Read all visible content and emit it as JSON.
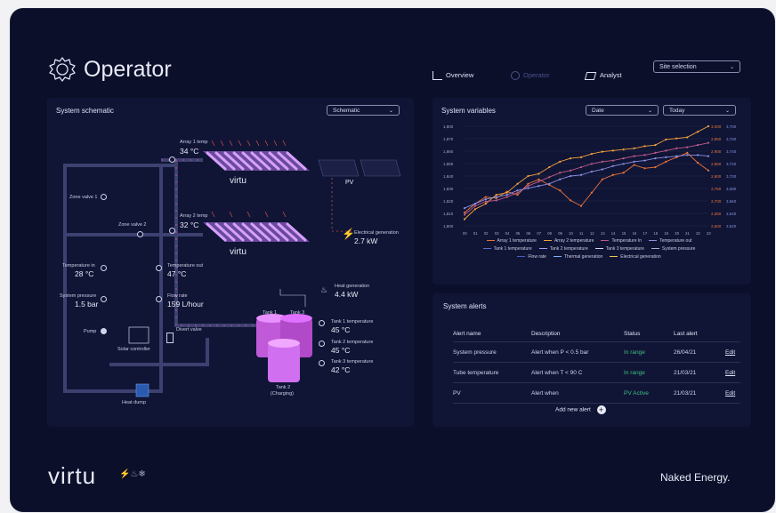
{
  "header": {
    "title": "Operator",
    "nav": [
      {
        "label": "Overview",
        "icon": "bar-chart-icon"
      },
      {
        "label": "Operator",
        "icon": "gear-icon"
      },
      {
        "label": "Analyst",
        "icon": "cube-icon"
      }
    ],
    "site_selection": "Site selection"
  },
  "schematic": {
    "title": "System schematic",
    "view_select": "Schematic",
    "array1": {
      "label": "Array 1 temp",
      "value": "34 °C"
    },
    "array2": {
      "label": "Array 2 temp",
      "value": "32 °C"
    },
    "array_brand": "virtu",
    "pv_label": "PV",
    "zone_valve_1": "Zone valve 1",
    "zone_valve_2": "Zone valve 2",
    "electrical_gen": {
      "label": "Electrical generation",
      "value": "2.7 kW"
    },
    "temp_in": {
      "label": "Temperature in",
      "value": "28 °C"
    },
    "temp_out": {
      "label": "Temperature out",
      "value": "47 °C"
    },
    "system_pressure": {
      "label": "System pressure",
      "value": "1.5 bar"
    },
    "flow_rate": {
      "label": "Flow rate",
      "value": "159 L/hour"
    },
    "heat_gen": {
      "label": "Heat generation",
      "value": "4.4 kW"
    },
    "pump": "Pump",
    "solar_controller": "Solar controller",
    "divert_valve": "Divert valve",
    "tank1": "Tank 1",
    "tank3": "Tank 3",
    "tank2": "Tank 2",
    "tank2_state": "(Charging)",
    "tank1_temp": {
      "label": "Tank 1 temperature",
      "value": "45 °C"
    },
    "tank2_temp": {
      "label": "Tank 2 temperature",
      "value": "45 °C"
    },
    "tank3_temp": {
      "label": "Tank 3 temperature",
      "value": "42 °C"
    },
    "heat_dump": "Heat dump"
  },
  "variables": {
    "title": "System variables",
    "date_select": "Date",
    "range_select": "Today"
  },
  "chart_data": {
    "type": "line",
    "x": [
      "00",
      "01",
      "02",
      "03",
      "04",
      "05",
      "06",
      "07",
      "08",
      "09",
      "10",
      "11",
      "12",
      "13",
      "14",
      "15",
      "16",
      "17",
      "18",
      "19",
      "20",
      "21",
      "22",
      "23"
    ],
    "left_ticks": [
      "1,800",
      "1,870",
      "1,860",
      "1,850",
      "1,840",
      "1,830",
      "1,820",
      "1,810",
      "1,800"
    ],
    "right_ticks_a": [
      "3,000",
      "2,950",
      "2,900",
      "2,850",
      "2,800",
      "2,750",
      "2,700",
      "2,650",
      "2,600"
    ],
    "right_ticks_b": [
      "3,700",
      "3,760",
      "3,740",
      "3,720",
      "3,700",
      "3,680",
      "3,660",
      "3,640",
      "3,620"
    ],
    "series": [
      {
        "name": "Array 1 temperature",
        "color": "#e8733a",
        "values": [
          1812,
          1820,
          1826,
          1825,
          1831,
          1828,
          1838,
          1842,
          1837,
          1832,
          1823,
          1818,
          1830,
          1842,
          1846,
          1848,
          1855,
          1852,
          1853,
          1858,
          1862,
          1866,
          1857,
          1850
        ]
      },
      {
        "name": "Array 2 temperature",
        "color": "#f2a03a",
        "values": [
          1806,
          1815,
          1820,
          1828,
          1830,
          1838,
          1845,
          1847,
          1853,
          1858,
          1861,
          1862,
          1865,
          1867,
          1868,
          1869,
          1870,
          1872,
          1873,
          1878,
          1879,
          1880,
          1885,
          1890
        ]
      },
      {
        "name": "Temperature In",
        "color": "#c05a8a",
        "values": [
          1810,
          1818,
          1822,
          1823,
          1826,
          1830,
          1836,
          1840,
          1844,
          1848,
          1850,
          1853,
          1856,
          1858,
          1859,
          1861,
          1863,
          1864,
          1866,
          1868,
          1870,
          1871,
          1873,
          1875
        ]
      },
      {
        "name": "Temperature out",
        "color": "#8a8fe0",
        "values": [
          1816,
          1820,
          1824,
          1826,
          1828,
          1832,
          1834,
          1836,
          1838,
          1842,
          1845,
          1846,
          1849,
          1851,
          1854,
          1856,
          1858,
          1859,
          1861,
          1862,
          1863,
          1864,
          1864,
          1863
        ]
      }
    ],
    "legend": [
      "Array 1 temperature",
      "Array 2 temperature",
      "Temperature In",
      "Temperature out",
      "Tank 1 temperature",
      "Tank 2 temperature",
      "Tank 3 temperature",
      "System pressure",
      "Flow rate",
      "Thermal generation",
      "Electrical generation"
    ],
    "legend_colors": [
      "#e8733a",
      "#f2a03a",
      "#c05a8a",
      "#8a8fe0",
      "#5a6fd0",
      "#9aa4ff",
      "#d6d8f2",
      "#b0b3d0",
      "#4a5cc0",
      "#7fb0ff",
      "#f2c55a"
    ],
    "ylim": [
      1800,
      1890
    ]
  },
  "alerts": {
    "title": "System alerts",
    "headers": [
      "Alert name",
      "Description",
      "Status",
      "Last alert"
    ],
    "rows": [
      {
        "name": "System pressure",
        "desc": "Alert when P < 0.5 bar",
        "status": "In range",
        "last": "26/04/21",
        "edit": "Edit"
      },
      {
        "name": "Tube temperature",
        "desc": "Alert when T < 90 C",
        "status": "In range",
        "last": "21/03/21",
        "edit": "Edit"
      },
      {
        "name": "PV",
        "desc": "Alert when",
        "status": "PV Active",
        "last": "21/03/21",
        "edit": "Edit"
      }
    ],
    "add_label": "Add new alert"
  },
  "footer": {
    "logo": "virtu",
    "brand": "Naked Energy."
  },
  "colors": {
    "bg": "#0b0f2a",
    "panel": "#101536",
    "accent": "#e070ff",
    "green": "#3fbf7f"
  }
}
